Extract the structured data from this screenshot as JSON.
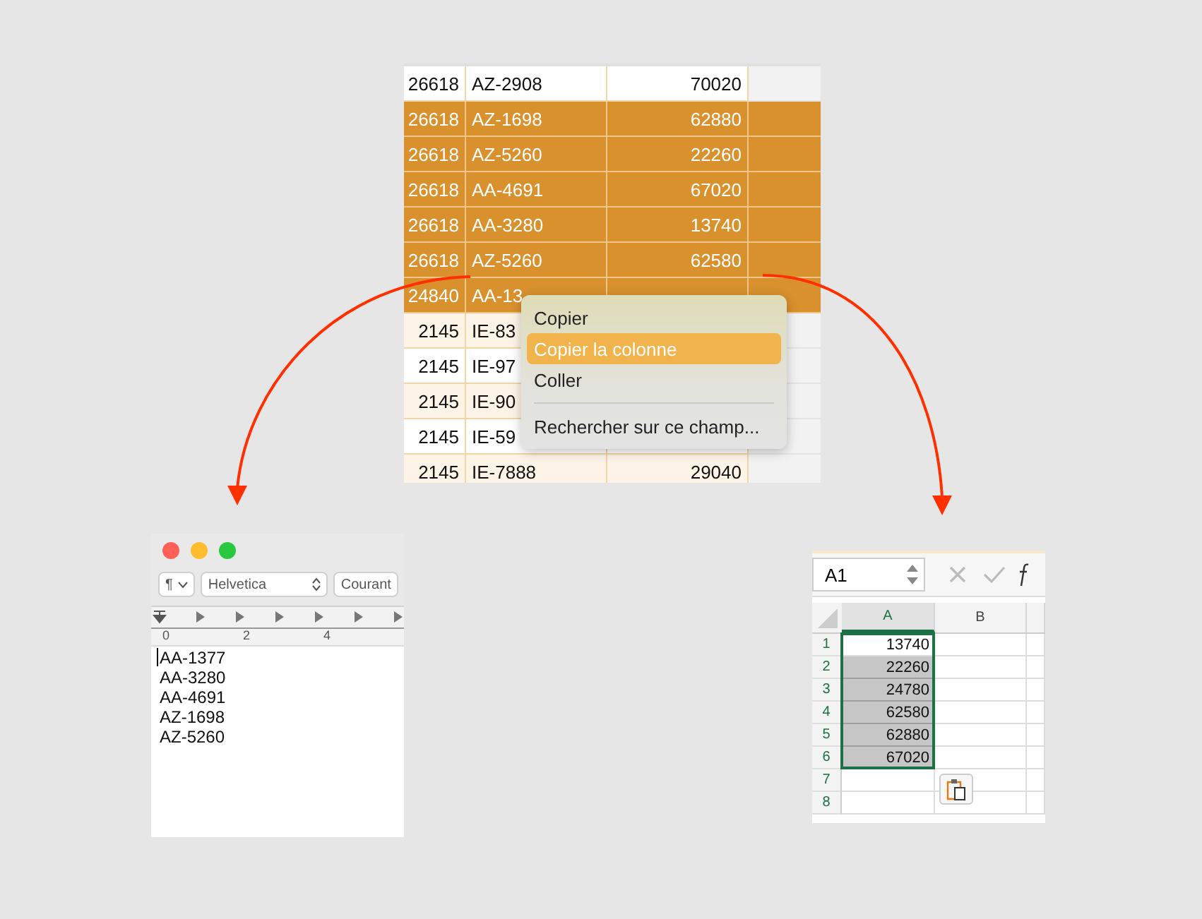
{
  "table": {
    "rows": [
      {
        "id": "26618",
        "code": "AZ-2908",
        "amount": "70020",
        "selected": false
      },
      {
        "id": "26618",
        "code": "AZ-1698",
        "amount": "62880",
        "selected": true
      },
      {
        "id": "26618",
        "code": "AZ-5260",
        "amount": "22260",
        "selected": true
      },
      {
        "id": "26618",
        "code": "AA-4691",
        "amount": "67020",
        "selected": true
      },
      {
        "id": "26618",
        "code": "AA-3280",
        "amount": "13740",
        "selected": true
      },
      {
        "id": "26618",
        "code": "AZ-5260",
        "amount": "62580",
        "selected": true
      },
      {
        "id": "24840",
        "code": "AA-13",
        "selected": true
      },
      {
        "id": "2145",
        "code": "IE-83",
        "selected": false
      },
      {
        "id": "2145",
        "code": "IE-97",
        "selected": false
      },
      {
        "id": "2145",
        "code": "IE-90",
        "selected": false
      },
      {
        "id": "2145",
        "code": "IE-59",
        "selected": false
      },
      {
        "id": "2145",
        "code": "IE-7888",
        "amount": "29040",
        "selected": false
      }
    ]
  },
  "context_menu": {
    "items": [
      {
        "kind": "item",
        "label": "Copier",
        "selected": false
      },
      {
        "kind": "item",
        "label": "Copier la colonne",
        "selected": true
      },
      {
        "kind": "item",
        "label": "Coller",
        "selected": false
      },
      {
        "kind": "separator"
      },
      {
        "kind": "item",
        "label": "Rechercher sur ce champ...",
        "selected": false
      }
    ]
  },
  "text_editor": {
    "paragraph_button": "¶",
    "font": "Helvetica",
    "style": "Courant",
    "ruler_labels": [
      "0",
      "2",
      "4"
    ],
    "lines": [
      "AA-1377",
      "AA-3280",
      "AA-4691",
      "AZ-1698",
      "AZ-5260"
    ]
  },
  "spreadsheet": {
    "name_box": "A1",
    "columns": [
      {
        "label": "A",
        "selected": true
      },
      {
        "label": "B",
        "selected": false
      }
    ],
    "rows": [
      {
        "number": "1",
        "value": "13740",
        "selected": false
      },
      {
        "number": "2",
        "value": "22260",
        "selected": true
      },
      {
        "number": "3",
        "value": "24780",
        "selected": true
      },
      {
        "number": "4",
        "value": "62580",
        "selected": true
      },
      {
        "number": "5",
        "value": "62880",
        "selected": true
      },
      {
        "number": "6",
        "value": "67020",
        "selected": true
      },
      {
        "number": "7"
      },
      {
        "number": "8"
      }
    ]
  }
}
